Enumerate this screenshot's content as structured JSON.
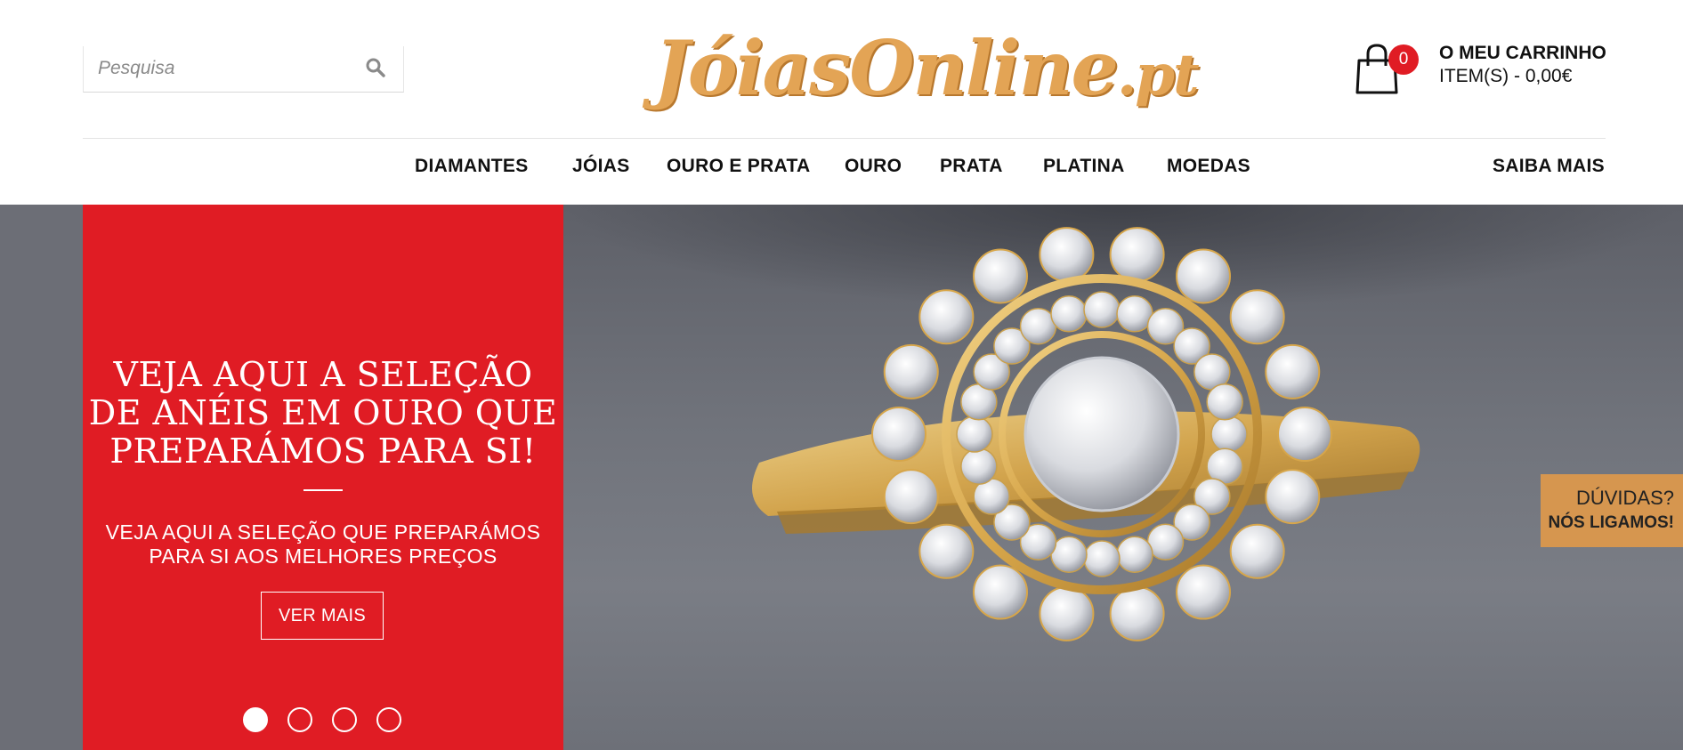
{
  "colors": {
    "brand_red": "#e01c24",
    "logo_gold": "#e3a455",
    "help_tab": "#d6964f"
  },
  "search": {
    "placeholder": "Pesquisa",
    "icon": "search-icon"
  },
  "logo": {
    "main": "JóiasOnline",
    "tld": ".pt"
  },
  "cart": {
    "icon": "shopping-bag-icon",
    "count": "0",
    "title": "O MEU CARRINHO",
    "summary": "ITEM(S) - 0,00€"
  },
  "nav": {
    "items": [
      "DIAMANTES",
      "JÓIAS",
      "OURO E PRATA",
      "OURO",
      "PRATA",
      "PLATINA",
      "MOEDAS"
    ],
    "more": "SAIBA MAIS"
  },
  "hero": {
    "title": "VEJA AQUI A SELEÇÃO DE ANÉIS EM OURO QUE PREPARÁMOS PARA SI!",
    "subtitle": "VEJA AQUI A SELEÇÃO QUE PREPARÁMOS PARA SI AOS MELHORES PREÇOS",
    "button": "VER MAIS",
    "slides_total": 4,
    "active_slide": 1
  },
  "help": {
    "question": "DÚVIDAS?",
    "call": "NÓS LIGAMOS!"
  }
}
